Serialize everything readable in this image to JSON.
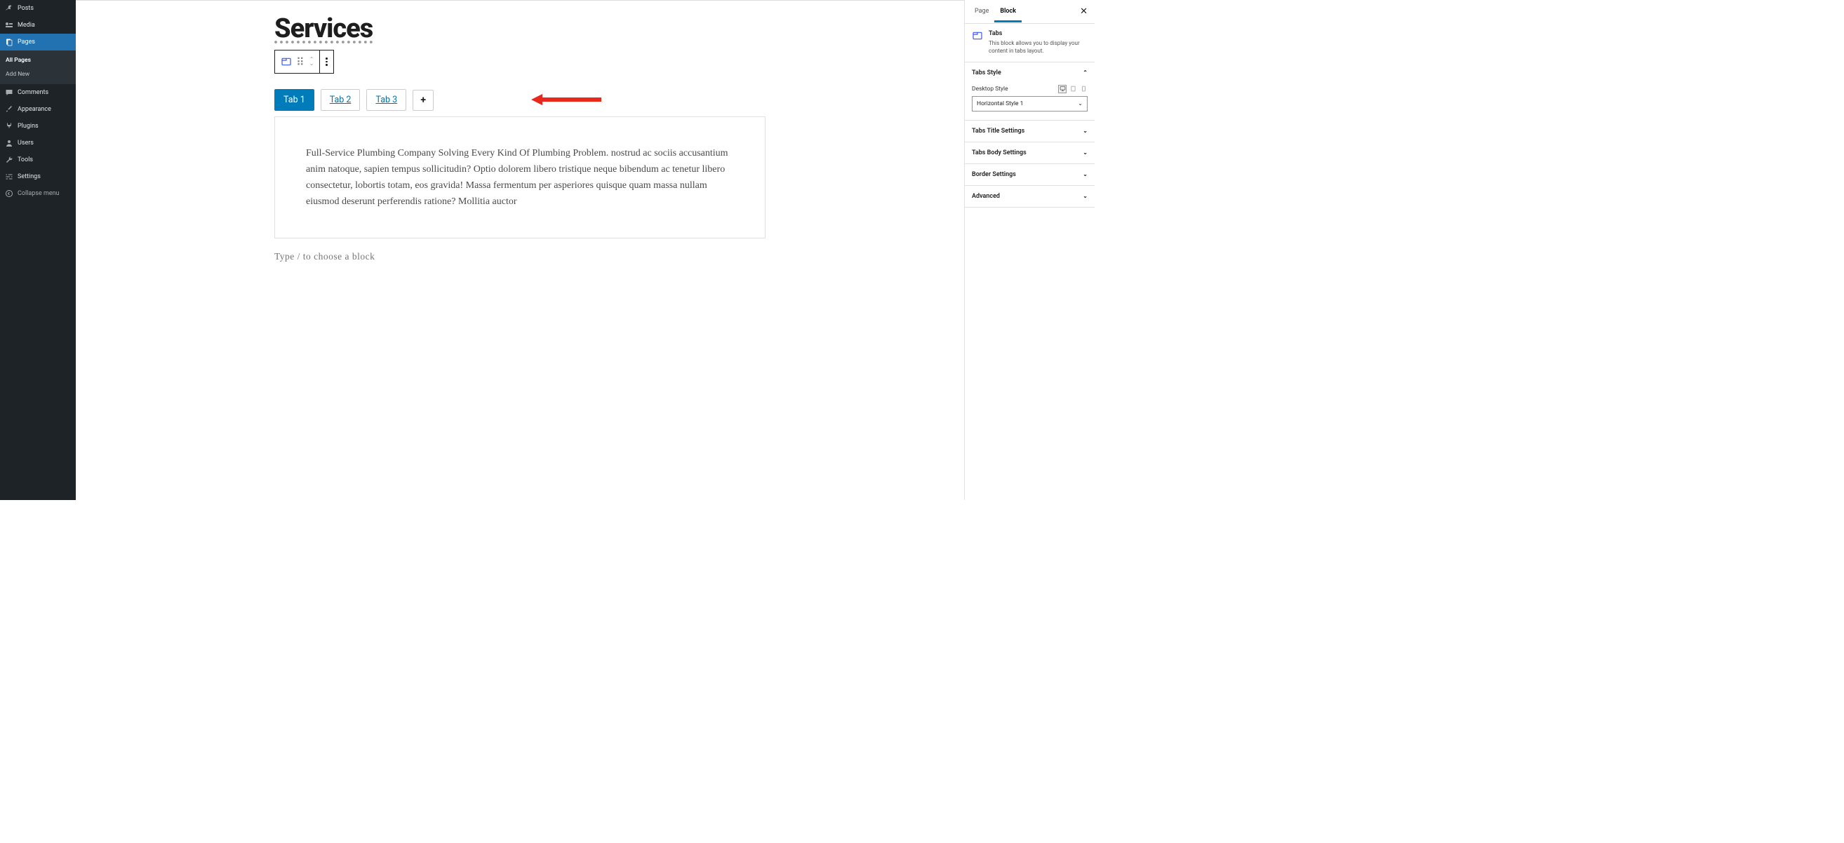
{
  "sidebar": {
    "items": [
      {
        "icon": "pin",
        "label": "Posts"
      },
      {
        "icon": "media",
        "label": "Media"
      },
      {
        "icon": "pages",
        "label": "Pages"
      },
      {
        "icon": "comment",
        "label": "Comments"
      },
      {
        "icon": "brush",
        "label": "Appearance"
      },
      {
        "icon": "plug",
        "label": "Plugins"
      },
      {
        "icon": "user",
        "label": "Users"
      },
      {
        "icon": "wrench",
        "label": "Tools"
      },
      {
        "icon": "sliders",
        "label": "Settings"
      },
      {
        "icon": "collapse",
        "label": "Collapse menu"
      }
    ],
    "pages_sub": [
      {
        "label": "All Pages",
        "current": true
      },
      {
        "label": "Add New",
        "current": false
      }
    ]
  },
  "editor": {
    "page_title": "Services",
    "tabs": [
      {
        "label": "Tab 1",
        "active": true
      },
      {
        "label": "Tab 2",
        "active": false
      },
      {
        "label": "Tab 3",
        "active": false
      }
    ],
    "add_tab_glyph": "+",
    "tab_body_text": "Full-Service Plumbing Company Solving Every Kind Of Plumbing Problem. nostrud ac sociis accusantium anim natoque, sapien tempus sollicitudin? Optio dolorem libero tristique neque bibendum ac tenetur libero consectetur, lobortis totam, eos gravida! Massa fermentum per asperiores quisque quam massa nullam eiusmod deserunt perferendis ratione? Mollitia auctor",
    "placeholder": "Type / to choose a block"
  },
  "inspector": {
    "tabs": [
      {
        "label": "Page",
        "active": false
      },
      {
        "label": "Block",
        "active": true
      }
    ],
    "block_title": "Tabs",
    "block_desc": "This block allows you to display your content in tabs layout.",
    "sections": [
      {
        "title": "Tabs Style",
        "open": true,
        "fields": {
          "desktop_style_label": "Desktop Style",
          "desktop_style_value": "Horizontal Style 1"
        }
      },
      {
        "title": "Tabs Title Settings",
        "open": false
      },
      {
        "title": "Tabs Body Settings",
        "open": false
      },
      {
        "title": "Border Settings",
        "open": false
      },
      {
        "title": "Advanced",
        "open": false
      }
    ]
  }
}
